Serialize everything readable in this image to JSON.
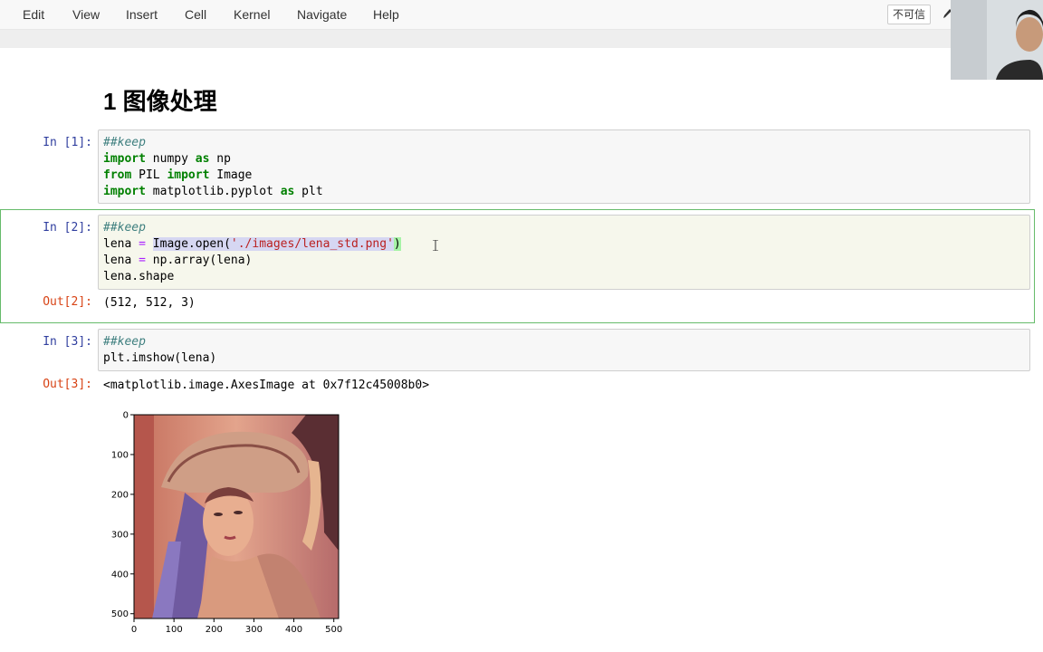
{
  "menu": [
    "Edit",
    "View",
    "Insert",
    "Cell",
    "Kernel",
    "Navigate",
    "Help"
  ],
  "toolbar": {
    "trust_label": "不可信"
  },
  "notebook": {
    "heading": "1  图像处理",
    "cells": [
      {
        "prompt": "In [1]:",
        "lines": [
          [
            [
              "comment",
              "##keep"
            ]
          ],
          [
            [
              "keyword",
              "import"
            ],
            [
              "plain",
              " numpy "
            ],
            [
              "keyword",
              "as"
            ],
            [
              "plain",
              " np"
            ]
          ],
          [
            [
              "keyword",
              "from"
            ],
            [
              "plain",
              " PIL "
            ],
            [
              "keyword",
              "import"
            ],
            [
              "plain",
              " Image"
            ]
          ],
          [
            [
              "keyword",
              "import"
            ],
            [
              "plain",
              " matplotlib.pyplot "
            ],
            [
              "keyword",
              "as"
            ],
            [
              "plain",
              " plt"
            ]
          ]
        ]
      },
      {
        "prompt": "In [2]:",
        "lines": [
          [
            [
              "comment",
              "##keep"
            ]
          ],
          [
            [
              "plain",
              "lena "
            ],
            [
              "op",
              "="
            ],
            [
              "plain",
              " "
            ],
            [
              "sel",
              "Image.open("
            ],
            [
              "sel-string",
              "'./images/lena_std.png'"
            ],
            [
              "match",
              ")"
            ]
          ],
          [
            [
              "plain",
              "lena "
            ],
            [
              "op",
              "="
            ],
            [
              "plain",
              " np.array(lena)"
            ]
          ],
          [
            [
              "plain",
              "lena.shape"
            ]
          ]
        ],
        "out_prompt": "Out[2]:",
        "output": "(512, 512, 3)"
      },
      {
        "prompt": "In [3]:",
        "lines": [
          [
            [
              "comment",
              "##keep"
            ]
          ],
          [
            [
              "plain",
              "plt.imshow(lena)"
            ]
          ]
        ],
        "out_prompt": "Out[3]:",
        "output": "<matplotlib.image.AxesImage at 0x7f12c45008b0>"
      }
    ]
  },
  "plot": {
    "x_ticks": [
      0,
      100,
      200,
      300,
      400,
      500
    ],
    "y_ticks": [
      0,
      100,
      200,
      300,
      400,
      500
    ],
    "x_range": [
      0,
      512
    ],
    "y_range": [
      0,
      512
    ]
  },
  "colors": {
    "selected_border": "#66bb6a",
    "in_prompt": "#303f9f",
    "out_prompt": "#d84315"
  }
}
